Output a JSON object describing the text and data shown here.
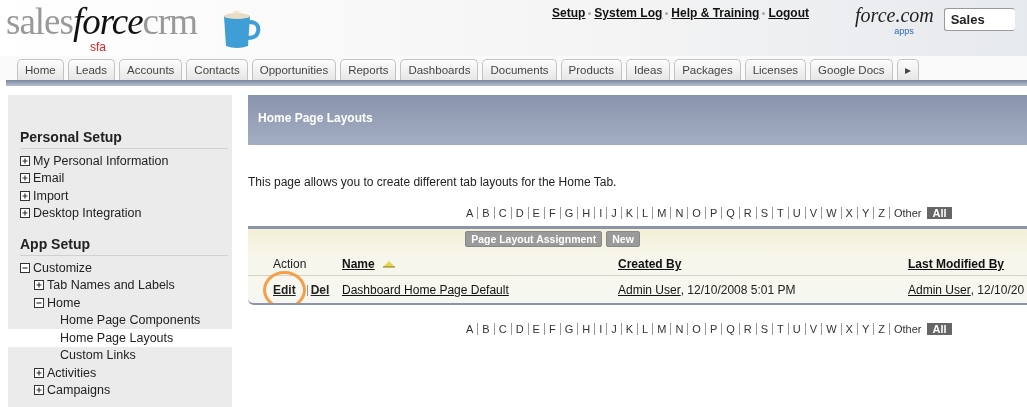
{
  "header": {
    "logo": [
      "sales",
      "force",
      "crm"
    ],
    "logo_sub": "sfa",
    "links": [
      "Setup",
      "System Log",
      "Help & Training",
      "Logout"
    ],
    "platform_logo": "force.com",
    "platform_sub": "apps",
    "app_menu": "Sales"
  },
  "tabs": [
    {
      "label": "Home",
      "selected": false
    },
    {
      "label": "Leads",
      "selected": false
    },
    {
      "label": "Accounts",
      "selected": false
    },
    {
      "label": "Contacts",
      "selected": false
    },
    {
      "label": "Opportunities",
      "selected": false
    },
    {
      "label": "Reports",
      "selected": false
    },
    {
      "label": "Dashboards",
      "selected": false
    },
    {
      "label": "Documents",
      "selected": false
    },
    {
      "label": "Products",
      "selected": false
    },
    {
      "label": "Ideas",
      "selected": false
    },
    {
      "label": "Packages",
      "selected": false
    },
    {
      "label": "Licenses",
      "selected": false
    },
    {
      "label": "Google Docs",
      "selected": false
    },
    {
      "label": "▸",
      "selected": false
    }
  ],
  "sidebar": {
    "sections": [
      {
        "title": "Personal Setup",
        "items": [
          {
            "label": "My Personal Information",
            "expanded": false,
            "selected": false
          },
          {
            "label": "Email",
            "expanded": false,
            "selected": false
          },
          {
            "label": "Import",
            "expanded": false,
            "selected": false
          },
          {
            "label": "Desktop Integration",
            "expanded": false,
            "selected": false
          }
        ]
      },
      {
        "title": "App Setup",
        "items": [
          {
            "label": "Customize",
            "expanded": true,
            "selected": false,
            "children": [
              {
                "label": "Tab Names and Labels",
                "expanded": false,
                "selected": false
              },
              {
                "label": "Home",
                "expanded": true,
                "selected": false,
                "children": [
                  {
                    "label": "Home Page Components",
                    "selected": false
                  },
                  {
                    "label": "Home Page Layouts",
                    "selected": true
                  },
                  {
                    "label": "Custom Links",
                    "selected": false
                  }
                ]
              },
              {
                "label": "Activities",
                "expanded": false,
                "selected": false
              },
              {
                "label": "Campaigns",
                "expanded": false,
                "selected": false
              }
            ]
          }
        ]
      }
    ]
  },
  "page": {
    "title": "Home Page Layouts",
    "description": "This page allows you to create different tab layouts for the Home Tab.",
    "alpha_filter_top": [
      {
        "label": "A",
        "selected": false
      },
      {
        "label": "B",
        "selected": false
      },
      {
        "label": "C",
        "selected": false
      },
      {
        "label": "D",
        "selected": false
      },
      {
        "label": "E",
        "selected": false
      },
      {
        "label": "F",
        "selected": false
      },
      {
        "label": "G",
        "selected": false
      },
      {
        "label": "H",
        "selected": false
      },
      {
        "label": "I",
        "selected": false
      },
      {
        "label": "J",
        "selected": false
      },
      {
        "label": "K",
        "selected": false
      },
      {
        "label": "L",
        "selected": false
      },
      {
        "label": "M",
        "selected": false
      },
      {
        "label": "N",
        "selected": false
      },
      {
        "label": "O",
        "selected": false
      },
      {
        "label": "P",
        "selected": false
      },
      {
        "label": "Q",
        "selected": false
      },
      {
        "label": "R",
        "selected": false
      },
      {
        "label": "S",
        "selected": false
      },
      {
        "label": "T",
        "selected": false
      },
      {
        "label": "U",
        "selected": false
      },
      {
        "label": "V",
        "selected": false
      },
      {
        "label": "W",
        "selected": false
      },
      {
        "label": "X",
        "selected": false
      },
      {
        "label": "Y",
        "selected": false
      },
      {
        "label": "Z",
        "selected": false
      },
      {
        "label": "Other",
        "selected": false
      },
      {
        "label": "All",
        "selected": true
      }
    ],
    "buttons": [
      "Page Layout Assignment",
      "New"
    ],
    "table": {
      "columns": [
        {
          "label": "Action",
          "link": false,
          "sorted": false
        },
        {
          "label": "Name",
          "link": true,
          "sorted": true
        },
        {
          "label": "Created By",
          "link": true,
          "sorted": false
        },
        {
          "label": "Last Modified By",
          "link": true,
          "sorted": false
        }
      ],
      "rows": [
        {
          "actions": [
            {
              "label": "Edit",
              "circled": true
            },
            {
              "label": "Del",
              "circled": false
            }
          ],
          "name": "Dashboard Home Page Default",
          "created_by": "Admin User",
          "created_at": ", 12/10/2008 5:01 PM",
          "modified_by": "Admin User",
          "modified_at": ", 12/10/20"
        }
      ]
    },
    "alpha_filter_bottom": [
      {
        "label": "A",
        "selected": false
      },
      {
        "label": "B",
        "selected": false
      },
      {
        "label": "C",
        "selected": false
      },
      {
        "label": "D",
        "selected": false
      },
      {
        "label": "E",
        "selected": false
      },
      {
        "label": "F",
        "selected": false
      },
      {
        "label": "G",
        "selected": false
      },
      {
        "label": "H",
        "selected": false
      },
      {
        "label": "I",
        "selected": false
      },
      {
        "label": "J",
        "selected": false
      },
      {
        "label": "K",
        "selected": false
      },
      {
        "label": "L",
        "selected": false
      },
      {
        "label": "M",
        "selected": false
      },
      {
        "label": "N",
        "selected": false
      },
      {
        "label": "O",
        "selected": false
      },
      {
        "label": "P",
        "selected": false
      },
      {
        "label": "Q",
        "selected": false
      },
      {
        "label": "R",
        "selected": false
      },
      {
        "label": "S",
        "selected": false
      },
      {
        "label": "T",
        "selected": false
      },
      {
        "label": "U",
        "selected": false
      },
      {
        "label": "V",
        "selected": false
      },
      {
        "label": "W",
        "selected": false
      },
      {
        "label": "X",
        "selected": false
      },
      {
        "label": "Y",
        "selected": false
      },
      {
        "label": "Z",
        "selected": false
      },
      {
        "label": "Other",
        "selected": false
      },
      {
        "label": "All",
        "selected": true
      }
    ]
  }
}
